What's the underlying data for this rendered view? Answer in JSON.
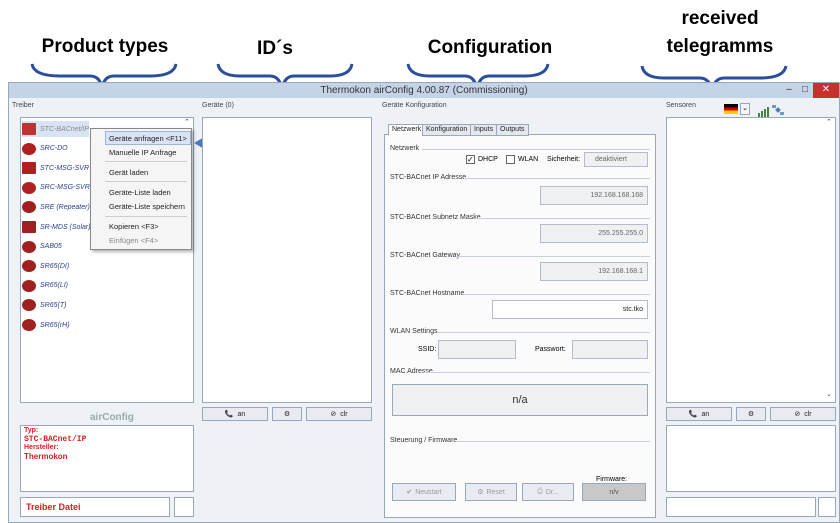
{
  "annotations": {
    "product_types": "Product types",
    "ids": "ID´s",
    "configuration": "Configuration",
    "received_1": "received",
    "received_2": "telegramms"
  },
  "window": {
    "title": "Thermokon airConfig 4.00.87 (Commissioning)",
    "min": "–",
    "max": "□",
    "close": "✕"
  },
  "panels": {
    "treiber": "Treiber",
    "geraete": "Geräte (0)",
    "konfig": "Geräte Konfiguration",
    "sensoren": "Sensoren"
  },
  "drivers": [
    {
      "label": "STC-BACnet/IP",
      "icon": "device-icon"
    },
    {
      "label": "SRC-DO",
      "icon": "device-icon"
    },
    {
      "label": "STC-MSG-SVR",
      "icon": "device-icon"
    },
    {
      "label": "SRC-MSG-SVR",
      "icon": "device-icon"
    },
    {
      "label": "SRE (Repeater)",
      "icon": "device-icon"
    },
    {
      "label": "SR-MDS (Solar)",
      "icon": "device-icon"
    },
    {
      "label": "SAB05",
      "icon": "device-icon"
    },
    {
      "label": "SR65(DI)",
      "icon": "device-icon"
    },
    {
      "label": "SR65(LI)",
      "icon": "device-icon"
    },
    {
      "label": "SR65(T)",
      "icon": "device-icon"
    },
    {
      "label": "SR65(rH)",
      "icon": "device-icon"
    }
  ],
  "context_menu": {
    "items": [
      "Geräte anfragen <F11>",
      "Manuelle IP Anfrage",
      "Gerät laden",
      "Geräte-Liste laden",
      "Geräte-Liste speichern",
      "Kopieren <F3>",
      "Einfügen <F4>"
    ]
  },
  "logo": "airConfig",
  "info": {
    "typ_label": "Typ:",
    "typ": "STC-BACnet/IP",
    "hersteller_label": "Hersteller:",
    "hersteller": "Thermokon",
    "treiber_datei": "Treiber Datei"
  },
  "buttons": {
    "an": "an",
    "clr": "clr",
    "an2": "an",
    "clr2": "clr"
  },
  "tabs": [
    "Netzwerk",
    "Konfiguration",
    "Inputs",
    "Outputs"
  ],
  "config": {
    "netzwerk": "Netzwerk",
    "dhcp": "DHCP",
    "wlan": "WLAN",
    "sicherheit": "Sicherheit:",
    "sicherheit_value": "deaktiviert",
    "ip_label": "STC-BACnet IP Adresse",
    "ip": "192.168.168.168",
    "mask_label": "STC-BACnet Subnetz Maske",
    "mask": "255.255.255.0",
    "gw_label": "STC-BACnet Gateway",
    "gw": "192.168.168.1",
    "host_label": "STC-BACnet Hostname",
    "host": "stc.tko",
    "wlan_label": "WLAN Settings",
    "ssid": "SSID:",
    "passwort": "Passwort:",
    "mac_label": "MAC Adresse",
    "mac": "n/a",
    "steuerung": "Steuerung / Firmware",
    "firmware_label": "Firmware:",
    "firmware": "n/v",
    "neustart": "Neustart",
    "reset": "Reset",
    "dr": "Dr..."
  },
  "colors": {
    "brace": "#2b4e9c",
    "arrow": "#4a78c2",
    "info_red": "#d42020"
  }
}
